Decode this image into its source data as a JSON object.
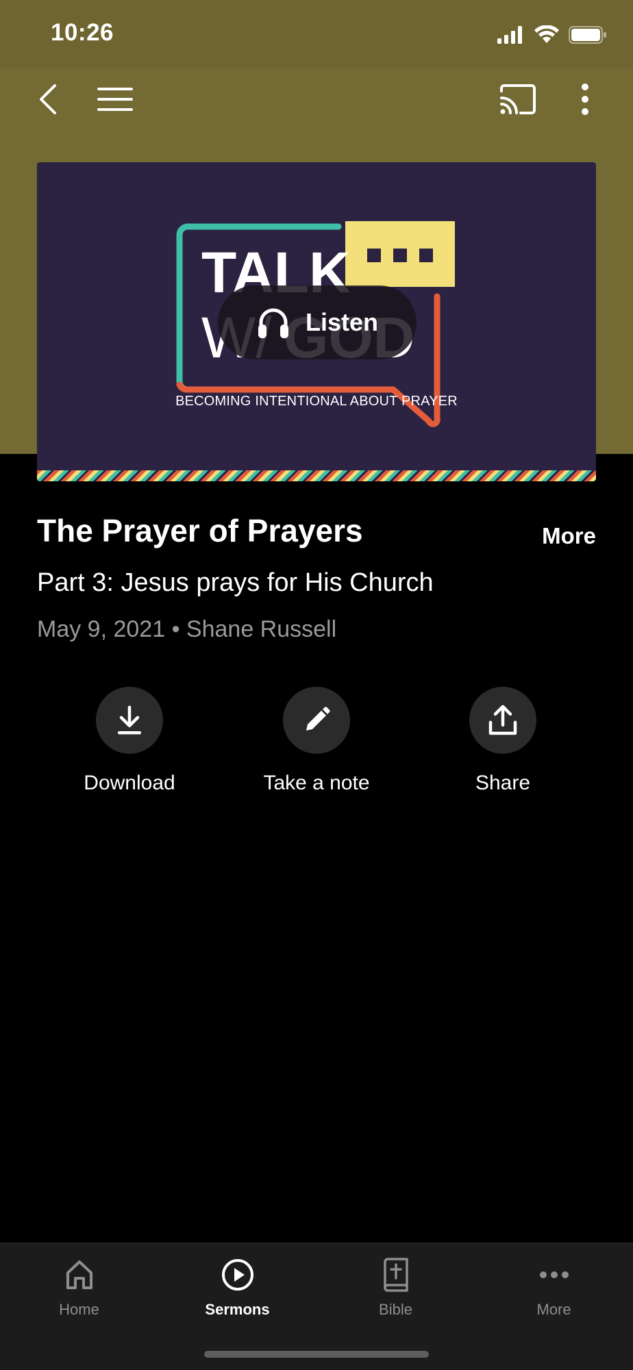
{
  "status_bar": {
    "time": "10:26"
  },
  "sermon": {
    "artwork": {
      "listen_label": "Listen",
      "logo_word_1": "TALK",
      "logo_word_2": "W/",
      "logo_word_3": "GOD",
      "tagline": "BECOMING INTENTIONAL ABOUT PRAYER"
    },
    "title": "The Prayer of Prayers",
    "more_label": "More",
    "subtitle": "Part 3: Jesus prays for His Church",
    "meta": "May 9, 2021 • Shane Russell"
  },
  "actions": [
    {
      "label": "Download",
      "icon": "download-icon"
    },
    {
      "label": "Take a note",
      "icon": "pencil-icon"
    },
    {
      "label": "Share",
      "icon": "share-icon"
    }
  ],
  "tabs": [
    {
      "label": "Home",
      "icon": "home-icon",
      "active": false
    },
    {
      "label": "Sermons",
      "icon": "play-circle-icon",
      "active": true
    },
    {
      "label": "Bible",
      "icon": "bible-icon",
      "active": false
    },
    {
      "label": "More",
      "icon": "ellipsis-icon",
      "active": false
    }
  ],
  "colors": {
    "header_bg": "#736a34",
    "artwork_bg": "#2c2242",
    "logo_teal": "#3fbfa8",
    "logo_orange": "#e45d3a",
    "logo_yellow": "#f3e07a",
    "tabbar_bg": "#1c1c1c"
  }
}
